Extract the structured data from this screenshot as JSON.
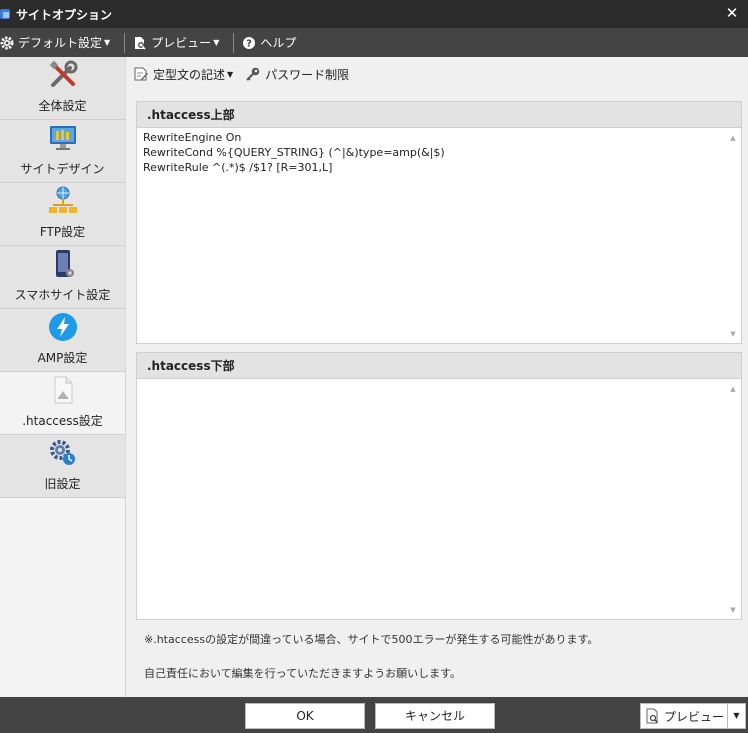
{
  "window": {
    "title": "サイトオプション"
  },
  "menubar": {
    "default_settings": "デフォルト設定",
    "preview": "プレビュー",
    "help": "ヘルプ"
  },
  "sidebar": {
    "items": [
      {
        "label": "全体設定",
        "icon": "tools-icon"
      },
      {
        "label": "サイトデザイン",
        "icon": "monitor-icon"
      },
      {
        "label": "FTP設定",
        "icon": "network-icon"
      },
      {
        "label": "スマホサイト設定",
        "icon": "smartphone-icon"
      },
      {
        "label": "AMP設定",
        "icon": "amp-bolt-icon"
      },
      {
        "label": ".htaccess設定",
        "icon": "document-icon"
      },
      {
        "label": "旧設定",
        "icon": "gears-icon"
      }
    ]
  },
  "toolbar": {
    "template": "定型文の記述",
    "password": "パスワード制限"
  },
  "upper": {
    "title": ".htaccess上部",
    "value": "RewriteEngine On\nRewriteCond %{QUERY_STRING} (^|&)type=amp(&|$)\nRewriteRule ^(.*)$ /$1? [R=301,L]"
  },
  "lower": {
    "title": ".htaccess下部",
    "value": ""
  },
  "notes": {
    "warning": "※.htaccessの設定が間違っている場合、サイトで500エラーが発生する可能性があります。",
    "responsibility": "自己責任において編集を行っていただきますようお願いします。"
  },
  "footer": {
    "ok": "OK",
    "cancel": "キャンセル",
    "preview": "プレビュー"
  },
  "colors": {
    "titlebar": "#2b2b2b",
    "menubar": "#444444",
    "amp_blue": "#1e9be8"
  }
}
